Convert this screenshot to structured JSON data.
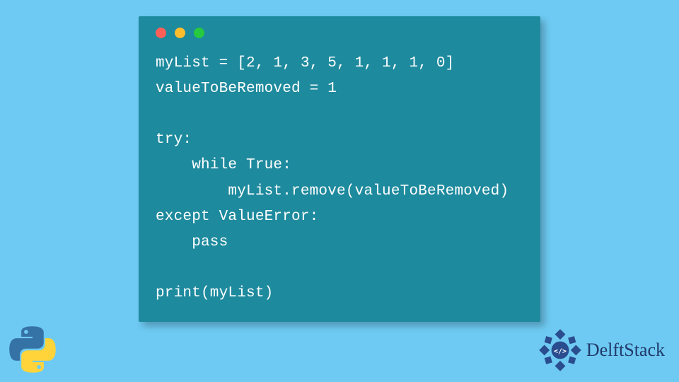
{
  "code": {
    "line1": "myList = [2, 1, 3, 5, 1, 1, 1, 0]",
    "line2": "valueToBeRemoved = 1",
    "line3": "",
    "line4": "try:",
    "line5": "    while True:",
    "line6": "        myList.remove(valueToBeRemoved)",
    "line7": "except ValueError:",
    "line8": "    pass",
    "line9": "",
    "line10": "print(myList)"
  },
  "brand": {
    "name": "DelftStack"
  },
  "colors": {
    "background": "#6ecaf2",
    "window": "#1e8a9e",
    "text": "#ffffff",
    "brand_text": "#213a6b",
    "dot_red": "#ff5f56",
    "dot_yellow": "#ffbd2e",
    "dot_green": "#27c93f"
  }
}
